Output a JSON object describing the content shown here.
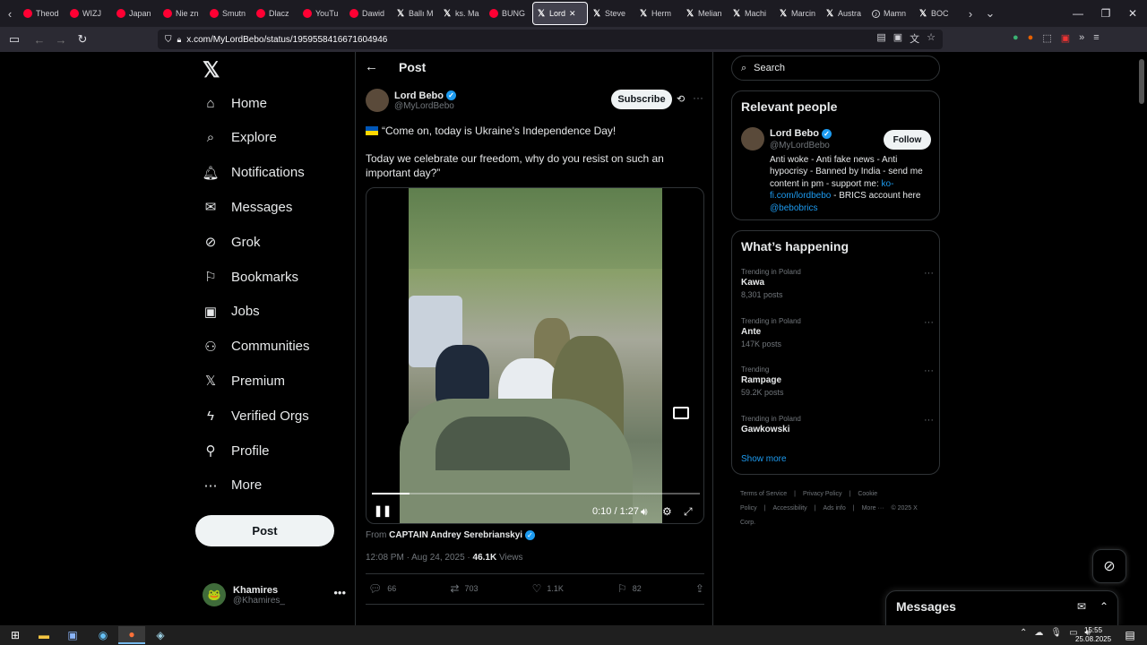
{
  "browser": {
    "tabs": [
      {
        "label": "Theod",
        "icon": "youtube"
      },
      {
        "label": "WIZJ",
        "icon": "youtube"
      },
      {
        "label": "Japan",
        "icon": "youtube"
      },
      {
        "label": "Nie zn",
        "icon": "youtube"
      },
      {
        "label": "Smutn",
        "icon": "youtube"
      },
      {
        "label": "Dlacz",
        "icon": "youtube"
      },
      {
        "label": "YouTu",
        "icon": "youtube"
      },
      {
        "label": "Dawid",
        "icon": "youtube"
      },
      {
        "label": "Ballı M",
        "icon": "x"
      },
      {
        "label": "ks. Ma",
        "icon": "x"
      },
      {
        "label": "BUNG",
        "icon": "youtube"
      },
      {
        "label": "Lord",
        "icon": "x",
        "active": true
      },
      {
        "label": "Steve",
        "icon": "x"
      },
      {
        "label": "Herm",
        "icon": "x"
      },
      {
        "label": "Melian",
        "icon": "x"
      },
      {
        "label": "Machi",
        "icon": "x"
      },
      {
        "label": "Marcin",
        "icon": "x"
      },
      {
        "label": "Austra",
        "icon": "x"
      },
      {
        "label": "Mamn",
        "icon": "tiktok"
      },
      {
        "label": "BOC",
        "icon": "x"
      }
    ],
    "url": "x.com/MyLordBebo/status/1959558416671604946"
  },
  "nav": {
    "items": [
      {
        "label": "Home",
        "icon": "home-icon"
      },
      {
        "label": "Explore",
        "icon": "search-icon"
      },
      {
        "label": "Notifications",
        "icon": "bell-icon"
      },
      {
        "label": "Messages",
        "icon": "mail-icon"
      },
      {
        "label": "Grok",
        "icon": "grok-icon"
      },
      {
        "label": "Bookmarks",
        "icon": "bookmark-icon"
      },
      {
        "label": "Jobs",
        "icon": "briefcase-icon"
      },
      {
        "label": "Communities",
        "icon": "people-icon"
      },
      {
        "label": "Premium",
        "icon": "x-icon"
      },
      {
        "label": "Verified Orgs",
        "icon": "bolt-icon"
      },
      {
        "label": "Profile",
        "icon": "person-icon"
      },
      {
        "label": "More",
        "icon": "more-circle-icon"
      }
    ],
    "post_label": "Post",
    "account": {
      "name": "Khamires",
      "handle": "@Khamires_"
    }
  },
  "post": {
    "header_title": "Post",
    "author_name": "Lord Bebo",
    "author_handle": "@MyLordBebo",
    "subscribe_label": "Subscribe",
    "text_line1": "“Come on, today is Ukraine’s Independence Day!",
    "text_line2": "Today we celebrate our freedom, why do you resist on such an important day?”",
    "video": {
      "time": "0:10 / 1:27",
      "progress": 0.115
    },
    "from_prefix": "From",
    "from_name": "CAPTAIN Andrey Serebrianskyi",
    "timestamp": "12:08 PM · Aug 24, 2025 ·",
    "views_count": "46.1K",
    "views_label": "Views",
    "replies": "66",
    "reposts": "703",
    "likes": "1.1K",
    "bookmarks": "82"
  },
  "sidebar": {
    "search_placeholder": "Search",
    "relevant_title": "Relevant people",
    "person": {
      "name": "Lord Bebo",
      "handle": "@MyLordBebo",
      "follow_label": "Follow",
      "bio_part1": "Anti woke - Anti fake news - Anti hypocrisy - Banned by India - send me content in pm - support me: ",
      "bio_link1": "ko-fi.com/lordbebo",
      "bio_part2": " - BRICS account here ",
      "bio_link2": "@bebobrics"
    },
    "happening_title": "What’s happening",
    "trends": [
      {
        "context": "Trending in Poland",
        "topic": "Kawa",
        "posts": "8,301 posts"
      },
      {
        "context": "Trending in Poland",
        "topic": "Ante",
        "posts": "147K posts"
      },
      {
        "context": "Trending",
        "topic": "Rampage",
        "posts": "59.2K posts"
      },
      {
        "context": "Trending in Poland",
        "topic": "Gawkowski",
        "posts": ""
      }
    ],
    "show_more": "Show more",
    "footer": [
      "Terms of Service",
      "|",
      "Privacy Policy",
      "|",
      "Cookie Policy",
      "|",
      "Accessibility",
      "|",
      "Ads info",
      "|",
      "More ···",
      "© 2025 X Corp."
    ]
  },
  "messages_drawer": {
    "title": "Messages"
  },
  "taskbar": {
    "time": "15:55",
    "date": "25.08.2025"
  },
  "colors": {
    "accent": "#1d9bf0",
    "background": "#000000",
    "border": "#2f3336",
    "muted": "#71767b"
  }
}
